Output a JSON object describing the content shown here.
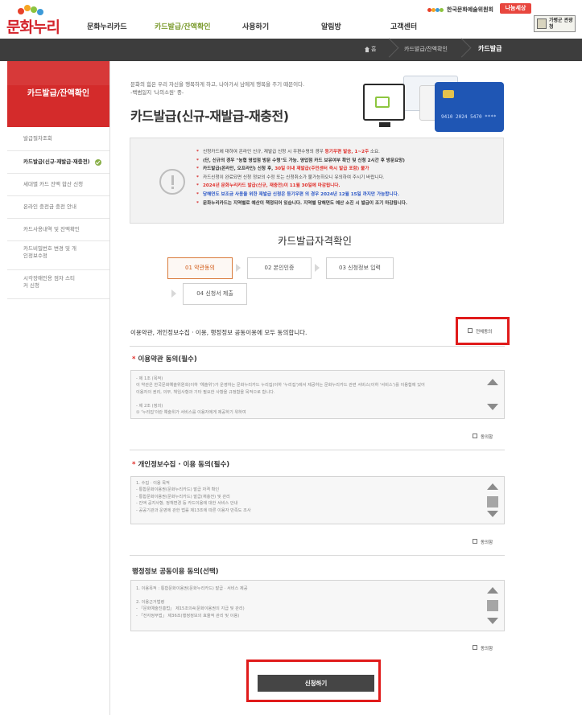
{
  "header": {
    "logo": "문화누리",
    "nav": [
      "문화누리카드",
      "카드발급/잔액확인",
      "사용하기",
      "알림방",
      "고객센터"
    ],
    "active_nav": 1,
    "org_name": "한국문화예술위원회",
    "org_badge": "나눔세상",
    "side_logo": "가평군 관광청"
  },
  "breadcrumb": {
    "home": "홈",
    "parent": "카드발급/잔액확인",
    "current": "카드발급"
  },
  "sidebar": {
    "title": "카드발급/잔액확인",
    "items": [
      "발급절차조회",
      "카드발급(신규·재발급·재충전)",
      "세대별 카드 잔액 합산 신청",
      "온라인 충전금 충전 안내",
      "카드사용내역 및 잔액확인",
      "카드비밀번호 변경 및 개인정보수정",
      "시각장애인용 점자 스티커 신청"
    ],
    "active_index": 1
  },
  "intro": {
    "line1": "문화의 힘은 우리 자신을 행복하게 하고, 나아가서 남에게 행복을 주기 때문이다.",
    "line2": "-백범일지 '나의소원' 중-"
  },
  "page_title": "카드발급(신규-재발급-재충전)",
  "card_number": "9410  2024  5470  ****",
  "notice": [
    {
      "pre": "신청카드에 대하여 온라인 신규, 재발급 신청 시 우편수령의 경우 ",
      "em": "등기우편 발송, 1~2주",
      "post": " 소요."
    },
    {
      "pre": "(단, 신규의 경우 ",
      "strong": "\"농협 영업점 방문 수령\"도 가능. 영업점 카드 보유여부 확인 및 신청 2시간 후 방문요망)"
    },
    {
      "strong": "카드발급(온라인, 오프라인) 신청 후, ",
      "em": "30일 이내 재발급(주민센터 즉시 발급 포함) 불가"
    },
    {
      "pre": "카드신청이 완료되면 신청 정보의 수정 또는 신청취소가 불가능하오니 유의하여 주시기 바랍니다."
    },
    {
      "em": "2024년 문화누리카드 발급(신규, 재충전)이 11월 30일에 마감됩니다."
    },
    {
      "blue": "당해연도 보조금 사용을 위한 재발급 신청은 등기우편 의 경우 2024년 12월 15일 까지만 가능합니다."
    },
    {
      "strong": "문화누리카드는 지역별로 예산이 책정되어 있습니다. 지역별 당해연도 예산 소진 시 발급이 조기 마감됩니다."
    }
  ],
  "eligibility_title": "카드발급자격확인",
  "steps": [
    "01 약관동의",
    "02 본인인증",
    "03 신청정보 입력",
    "04 신청서 제출"
  ],
  "active_step": 0,
  "all_agree": {
    "text": "이용약관, 개인정보수집 · 이용, 행정정보 공동이용에 모두 동의합니다.",
    "label": "전체동의"
  },
  "sections": [
    {
      "title": "이용약관 동의(필수)",
      "required": true,
      "lines": [
        "- 제 1조 (목적)",
        "이 약관은 한국문화예술위원회(이하 '예술위')가 운영하는 문화누리카드 누리집(이하 '누리집')에서 제공하는 문화누리카드 관련 서비스(이하 '서비스')를 이용함에 있어",
        "이용자의 권리, 의무, 책임사항과 기타 필요한 사항을 규정함을 목적으로 합니다.",
        "",
        "- 제 2조 (정의)",
        "① '누리집'이란 예술위가 서비스를 이용자에게 제공하기 위하여"
      ],
      "agree_label": "동의함"
    },
    {
      "title": "개인정보수집 · 이용 동의(필수)",
      "required": true,
      "lines": [
        "1. 수집 · 이용 목적",
        "- 통합문화이용권(문화누리카드) 발급 자격 확인",
        "- 통합문화이용권(문화누리카드) 발급(재충전) 및 관리",
        "- 잔액 공지사항, 정책변경 등 카드이용에 대한 서비스 안내",
        "- 공공기관과 운영에 관한 법률 제13조에 따른 이용자 만족도 조사"
      ],
      "agree_label": "동의함"
    },
    {
      "title": "행정정보 공동이용 동의(선택)",
      "required": false,
      "lines": [
        "1. 이용목적 : 통합문화이용권(문화누리카드) 발급 · 서비스 제공",
        "",
        "2. 이용근거법령",
        "- 「문화예술진흥법」 제15조의4(문화이용권의 지급 및 관리)",
        "- 「전자정부법」 제36조(행정정보의 효율적 관리 및 이용)"
      ],
      "agree_label": "동의함"
    }
  ],
  "submit_label": "신청하기",
  "colors": {
    "brand_red": "#d42b2b",
    "nav_active": "#7a9a2c",
    "highlight": "#e01b1b"
  }
}
